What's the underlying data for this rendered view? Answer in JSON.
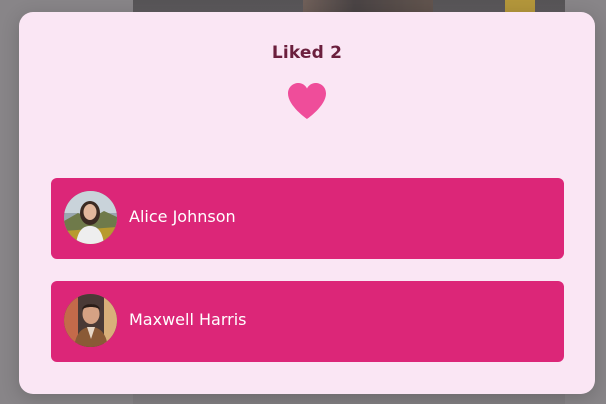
{
  "modal": {
    "title": "Liked 2",
    "heart_icon": "heart-icon",
    "heart_color": "#ef4d9a"
  },
  "users": [
    {
      "name": "Alice Johnson",
      "avatar_icon": "avatar"
    },
    {
      "name": "Maxwell Harris",
      "avatar_icon": "avatar"
    }
  ],
  "colors": {
    "row_background": "#dc2678",
    "modal_background": "#fae6f4",
    "title_color": "#6b1f3d"
  }
}
